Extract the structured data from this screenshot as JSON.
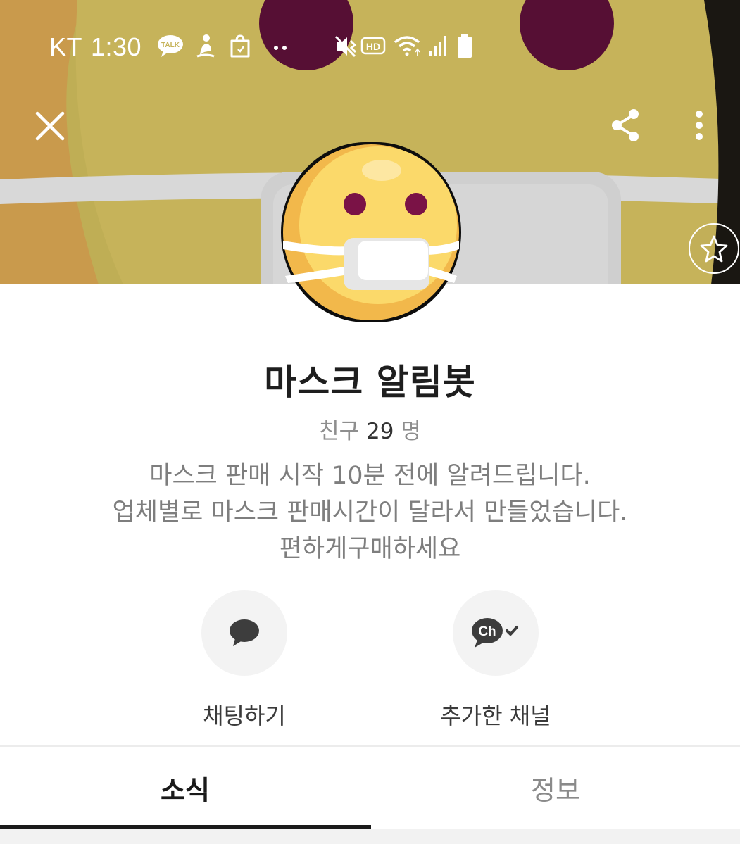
{
  "status_bar": {
    "carrier": "KT",
    "time": "1:30",
    "icons": [
      "talk-icon",
      "person-walk-icon",
      "bag-icon",
      "dots-icon",
      "mute-icon",
      "hd-icon",
      "wifi-icon",
      "signal-icon",
      "battery-icon"
    ],
    "talk_badge": "TALK",
    "hd_badge": "HD"
  },
  "header": {
    "close_icon": "close-icon",
    "share_icon": "share-icon",
    "more_icon": "more-vertical-icon",
    "favorite_icon": "star-icon"
  },
  "profile": {
    "name": "마스크 알림봇",
    "friends_label": "친구",
    "friends_count": "29",
    "friends_unit": "명",
    "description": [
      "마스크 판매 시작 10분 전에 알려드립니다.",
      "업체별로 마스크 판매시간이 달라서 만들었습니다.",
      "편하게구매하세요"
    ]
  },
  "actions": [
    {
      "label": "채팅하기",
      "icon": "chat-bubble-icon"
    },
    {
      "label": "추가한 채널",
      "icon": "channel-added-icon",
      "icon_text": "Ch"
    }
  ],
  "tabs": [
    {
      "label": "소식",
      "active": true
    },
    {
      "label": "정보",
      "active": false
    }
  ],
  "colors": {
    "cover_bg": "#bfae55",
    "face_yellow": "#fbd96a",
    "eye": "#7a1246",
    "text_dark": "#1e1e1e",
    "text_gray": "#7e7e7e"
  }
}
